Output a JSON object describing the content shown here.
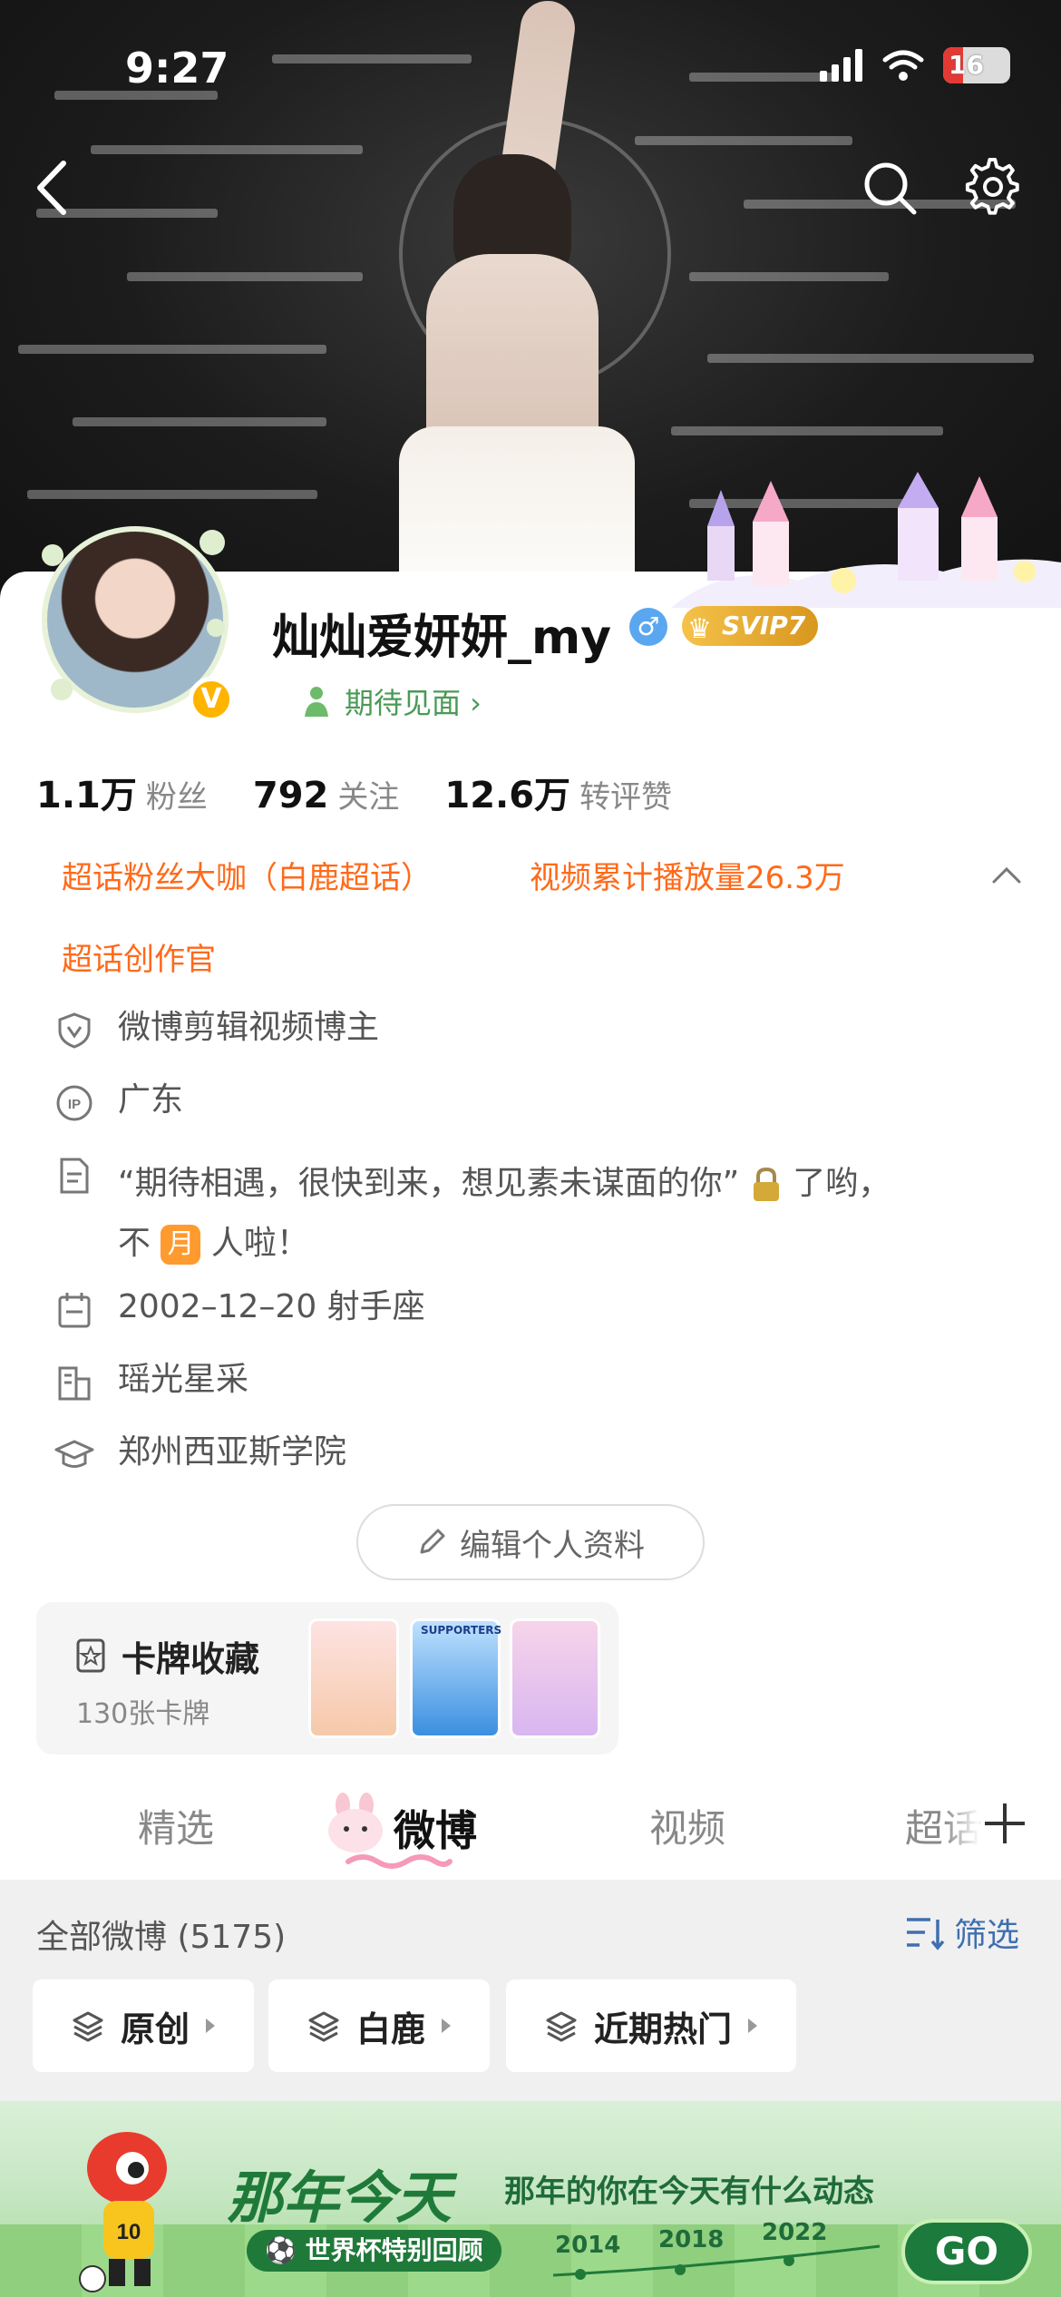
{
  "status_bar": {
    "time": "9:27",
    "battery": "16"
  },
  "profile": {
    "username": "灿灿爱妍妍_my",
    "gender_symbol": "♂",
    "vip_label": "SVIP7",
    "verified_mark": "V",
    "status_tag": "期待见面 ›"
  },
  "stats": [
    {
      "value": "1.1万",
      "label": "粉丝"
    },
    {
      "value": "792",
      "label": "关注"
    },
    {
      "value": "12.6万",
      "label": "转评赞"
    }
  ],
  "badges": [
    "超话粉丝大咖（白鹿超话）",
    "视频累计播放量26.3万",
    "超话创作官"
  ],
  "info": {
    "creator": "微博剪辑视频博主",
    "ip": "广东",
    "bio_part1": "“期待相遇，很快到来，想见素未谋面的你”",
    "bio_part2": "了哟，",
    "bio_part3": "不",
    "bio_moon": "月",
    "bio_part4": "人啦！",
    "birthday": "2002–12–20 射手座",
    "company": "瑶光星采",
    "school": "郑州西亚斯学院"
  },
  "edit_button": "编辑个人资料",
  "card_collection": {
    "title": "卡牌收藏",
    "count": "130张卡牌",
    "thumb2_label": "SUPPORTERS"
  },
  "tabs": [
    "精选",
    "微博",
    "视频",
    "超话"
  ],
  "feed": {
    "title": "全部微博 (5175)",
    "filter": "筛选",
    "chips": [
      "原创",
      "白鹿",
      "近期热门"
    ]
  },
  "banner": {
    "title": "那年今天",
    "subtitle": "那年的你在今天有什么动态",
    "pill": "世界杯特别回顾",
    "years": [
      "2014",
      "2018",
      "2022"
    ],
    "go": "GO"
  },
  "colors": {
    "accent_orange": "#ff6a1a",
    "link_blue": "#3f6fb0",
    "green": "#1f7a3a"
  }
}
